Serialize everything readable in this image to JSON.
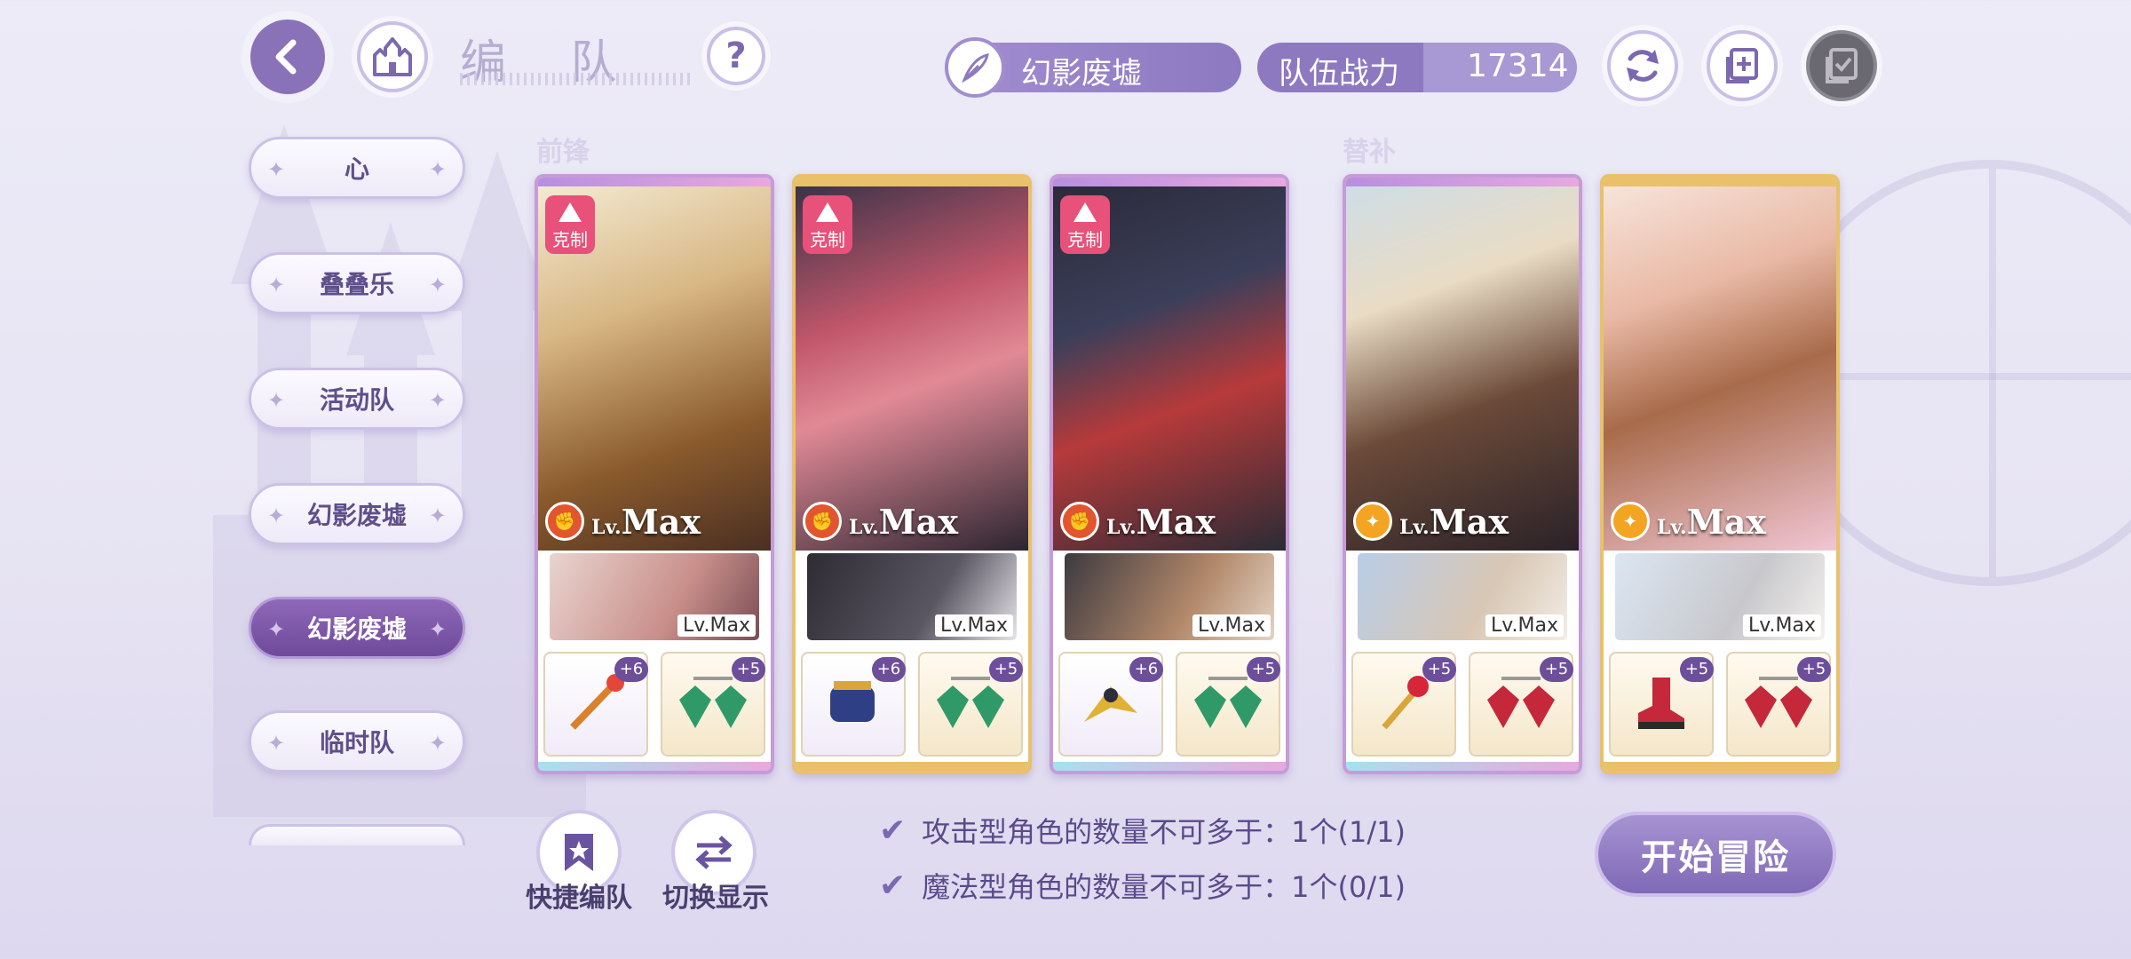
{
  "header": {
    "title": "编 队",
    "scene": "幻影废墟",
    "power_label": "队伍战力",
    "power_value": "17314"
  },
  "sidebar": {
    "items": [
      {
        "label": "心"
      },
      {
        "label": "叠叠乐"
      },
      {
        "label": "活动队"
      },
      {
        "label": "幻影废墟"
      },
      {
        "label": "幻影废墟",
        "active": true
      },
      {
        "label": "临时队"
      }
    ]
  },
  "sections": {
    "front": "前锋",
    "sub": "替补"
  },
  "cards": [
    {
      "counter": "克制",
      "level": "Max",
      "partner_level": "Lv.Max",
      "item1_plus": "+6",
      "item2_plus": "+5"
    },
    {
      "counter": "克制",
      "level": "Max",
      "partner_level": "Lv.Max",
      "item1_plus": "+6",
      "item2_plus": "+5"
    },
    {
      "counter": "克制",
      "level": "Max",
      "partner_level": "Lv.Max",
      "item1_plus": "+6",
      "item2_plus": "+5"
    },
    {
      "level": "Max",
      "partner_level": "Lv.Max",
      "item1_plus": "+5",
      "item2_plus": "+5"
    },
    {
      "level": "Max",
      "partner_level": "Lv.Max",
      "item1_plus": "+5",
      "item2_plus": "+5"
    }
  ],
  "lv_prefix": "Lv.",
  "bottom": {
    "quick_team": "快捷编队",
    "switch_display": "切换显示",
    "conditions": [
      "攻击型角色的数量不可多于：1个(1/1)",
      "魔法型角色的数量不可多于：1个(0/1)"
    ],
    "start": "开始冒险"
  },
  "colors": {
    "accent": "#8d79c0",
    "counter": "#e8517a",
    "element_red": "#e3552e",
    "element_gold": "#f3a521"
  }
}
